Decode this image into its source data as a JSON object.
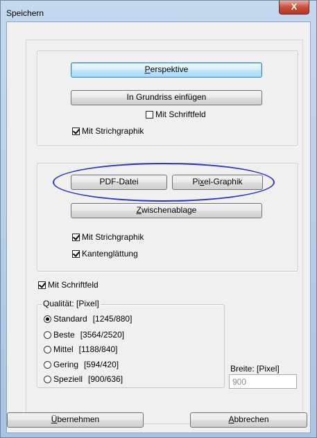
{
  "window": {
    "title": "Speichern",
    "close_label": "X"
  },
  "group_top": {
    "perspektive_prefix": "P",
    "perspektive_rest": "erspektive",
    "grundriss_label": "In Grundriss einfügen",
    "schriftfeld_label": "Mit Schriftfeld",
    "schriftfeld_checked": false,
    "strichgraphik_label": "Mit Strichgraphik",
    "strichgraphik_checked": true
  },
  "group_export": {
    "pdf_label": "PDF-Datei",
    "pixel_prefix": "Pi",
    "pixel_u": "x",
    "pixel_rest": "el-Graphik",
    "zwischen_prefix": "Z",
    "zwischen_rest": "wischenablage",
    "strichgraphik_label": "Mit Strichgraphik",
    "strichgraphik_checked": true,
    "kanten_label": "Kantenglättung",
    "kanten_checked": true,
    "annotation_color": "#2b2fd6"
  },
  "schriftfeld_main": {
    "label": "Mit Schriftfeld",
    "checked": true
  },
  "quality": {
    "legend": "Qualität: [Pixel]",
    "options": [
      {
        "name": "Standard",
        "size": "[1245/880]",
        "selected": true
      },
      {
        "name": "Beste",
        "size": "[3564/2520]",
        "selected": false
      },
      {
        "name": "Mittel",
        "size": "[1188/840]",
        "selected": false
      },
      {
        "name": "Gering",
        "size": "[594/420]",
        "selected": false
      },
      {
        "name": "Speziell",
        "size": "[900/636]",
        "selected": false
      }
    ]
  },
  "width_field": {
    "label": "Breite: [Pixel]",
    "value": "900"
  },
  "footer": {
    "apply_prefix": "Ü",
    "apply_rest": "bernehmen",
    "cancel_prefix": "A",
    "cancel_rest": "bbrechen"
  }
}
